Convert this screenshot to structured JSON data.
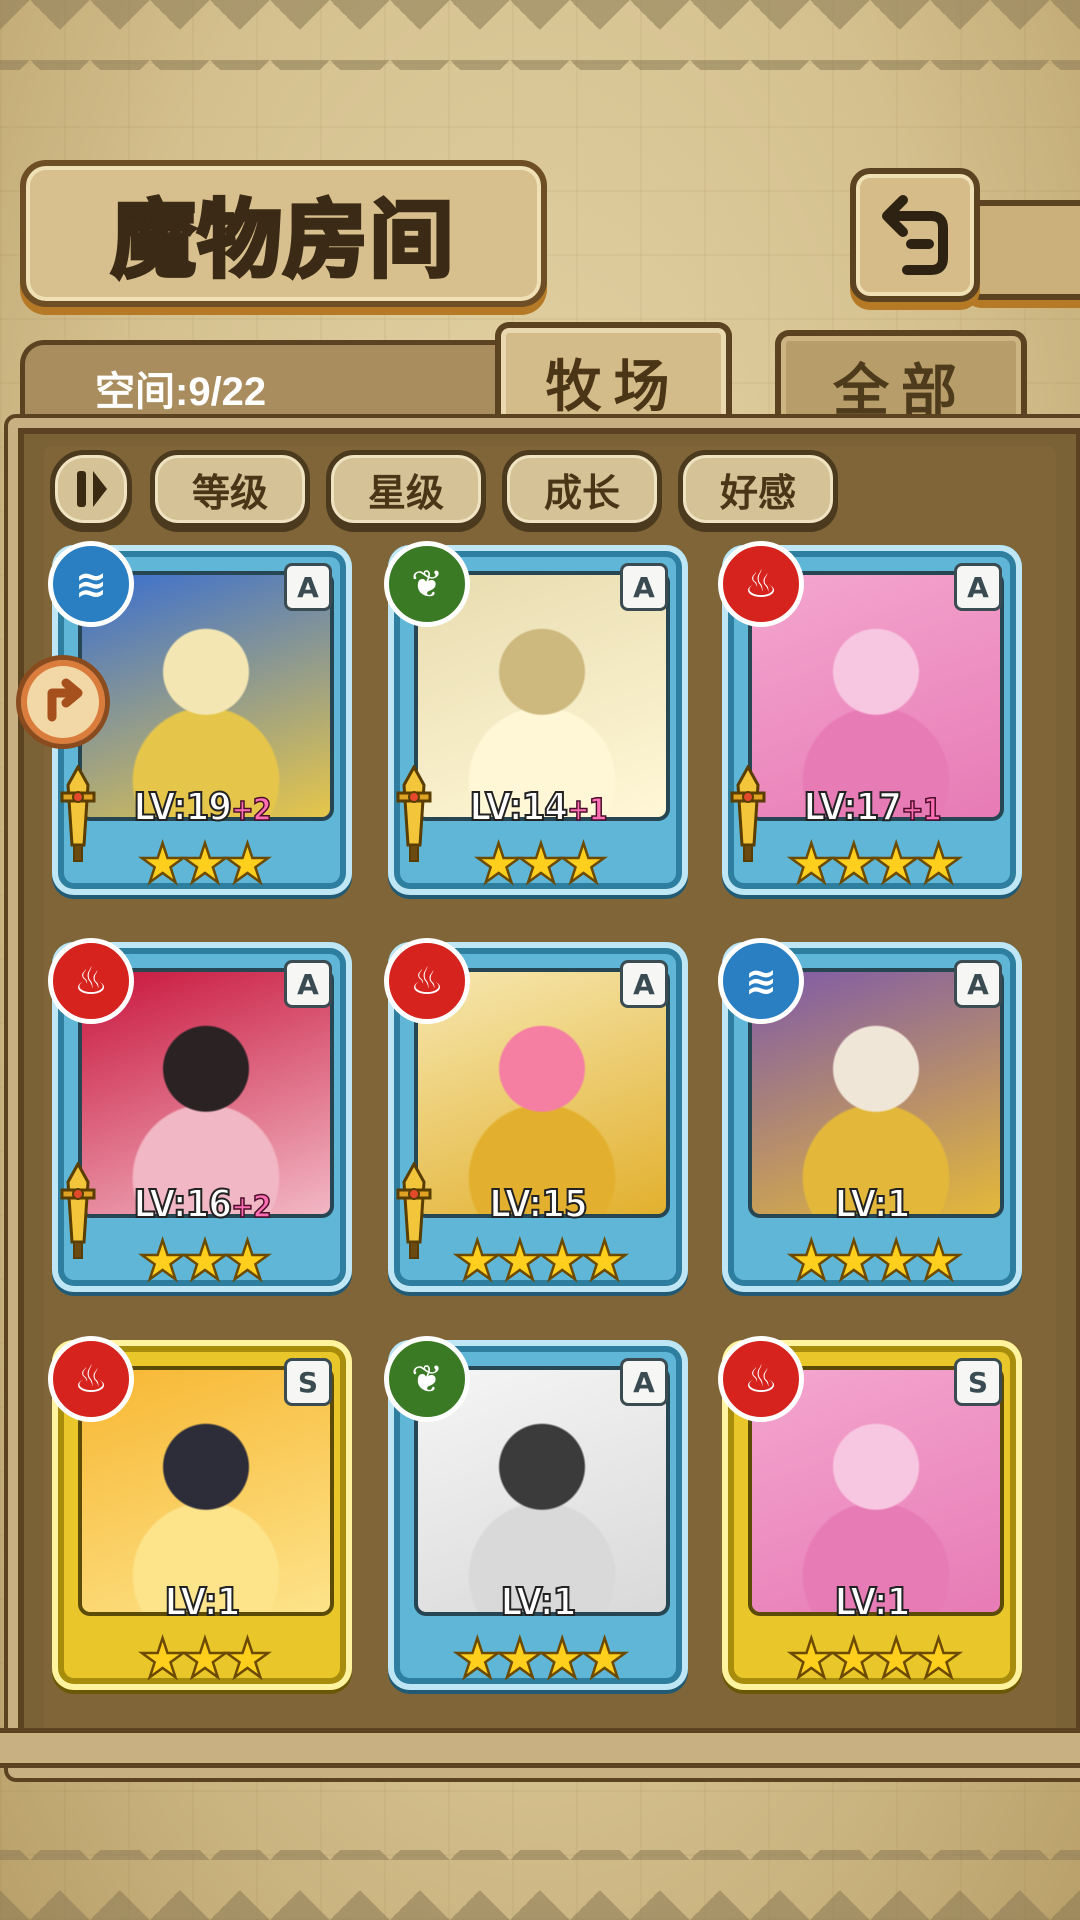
{
  "header": {
    "title": "魔物房间",
    "back_button_icon": "return-arrow-icon"
  },
  "tabs": {
    "space_label": "空间:9/22",
    "farm": "牧场",
    "all": "全部"
  },
  "filters": {
    "toggle_icon": "pause-toggle-icon",
    "level": "等级",
    "star": "星级",
    "growth": "成长",
    "favor": "好感"
  },
  "cards": [
    {
      "element": "water",
      "rank": "A",
      "frame": "blue",
      "lv": "LV:19",
      "bonus": "+2",
      "stars": "★★★",
      "weapon": true,
      "palette": [
        "#3a6fd1",
        "#f3e6b2",
        "#e6c64a"
      ]
    },
    {
      "element": "wood",
      "rank": "A",
      "frame": "blue",
      "lv": "LV:14",
      "bonus": "+1",
      "stars": "★★★",
      "weapon": true,
      "palette": [
        "#e8dcb0",
        "#cdb97e",
        "#fff7d6"
      ]
    },
    {
      "element": "fire",
      "rank": "A",
      "frame": "blue",
      "lv": "LV:17",
      "bonus": "+1",
      "stars": "★★★★",
      "weapon": true,
      "palette": [
        "#f4a6cf",
        "#f7c6e0",
        "#e77bb5"
      ]
    },
    {
      "element": "fire",
      "rank": "A",
      "frame": "blue",
      "lv": "LV:16",
      "bonus": "+2",
      "stars": "★★★",
      "weapon": true,
      "palette": [
        "#c8163d",
        "#2b2224",
        "#f2b7c4"
      ]
    },
    {
      "element": "fire",
      "rank": "A",
      "frame": "blue",
      "lv": "LV:15",
      "bonus": "",
      "stars": "★★★★",
      "weapon": true,
      "palette": [
        "#f6e7b0",
        "#f57ea3",
        "#e2b02e"
      ]
    },
    {
      "element": "water",
      "rank": "A",
      "frame": "blue",
      "lv": "LV:1",
      "bonus": "",
      "stars": "★★★★",
      "weapon": false,
      "palette": [
        "#7f5aa8",
        "#f0e6d8",
        "#e3b83a"
      ]
    },
    {
      "element": "fire",
      "rank": "S",
      "frame": "gold",
      "lv": "LV:1",
      "bonus": "",
      "stars": "★★★",
      "weapon": false,
      "palette": [
        "#f7b733",
        "#2d2d3a",
        "#fde38a"
      ]
    },
    {
      "element": "wood",
      "rank": "A",
      "frame": "blue",
      "lv": "LV:1",
      "bonus": "",
      "stars": "★★★★",
      "weapon": false,
      "palette": [
        "#f5f5f5",
        "#3b3b3b",
        "#d9d9d9"
      ]
    },
    {
      "element": "fire",
      "rank": "S",
      "frame": "gold",
      "lv": "LV:1",
      "bonus": "",
      "stars": "★★★★",
      "weapon": false,
      "palette": [
        "#f4a6cf",
        "#f7c6e0",
        "#e77bb5"
      ]
    }
  ],
  "colors": {
    "panel": "#7b6236",
    "parchment": "#d9c79a",
    "blue_frame": "#5fb6d6",
    "gold_frame": "#e9c72a",
    "star": "#ffcf1e"
  }
}
